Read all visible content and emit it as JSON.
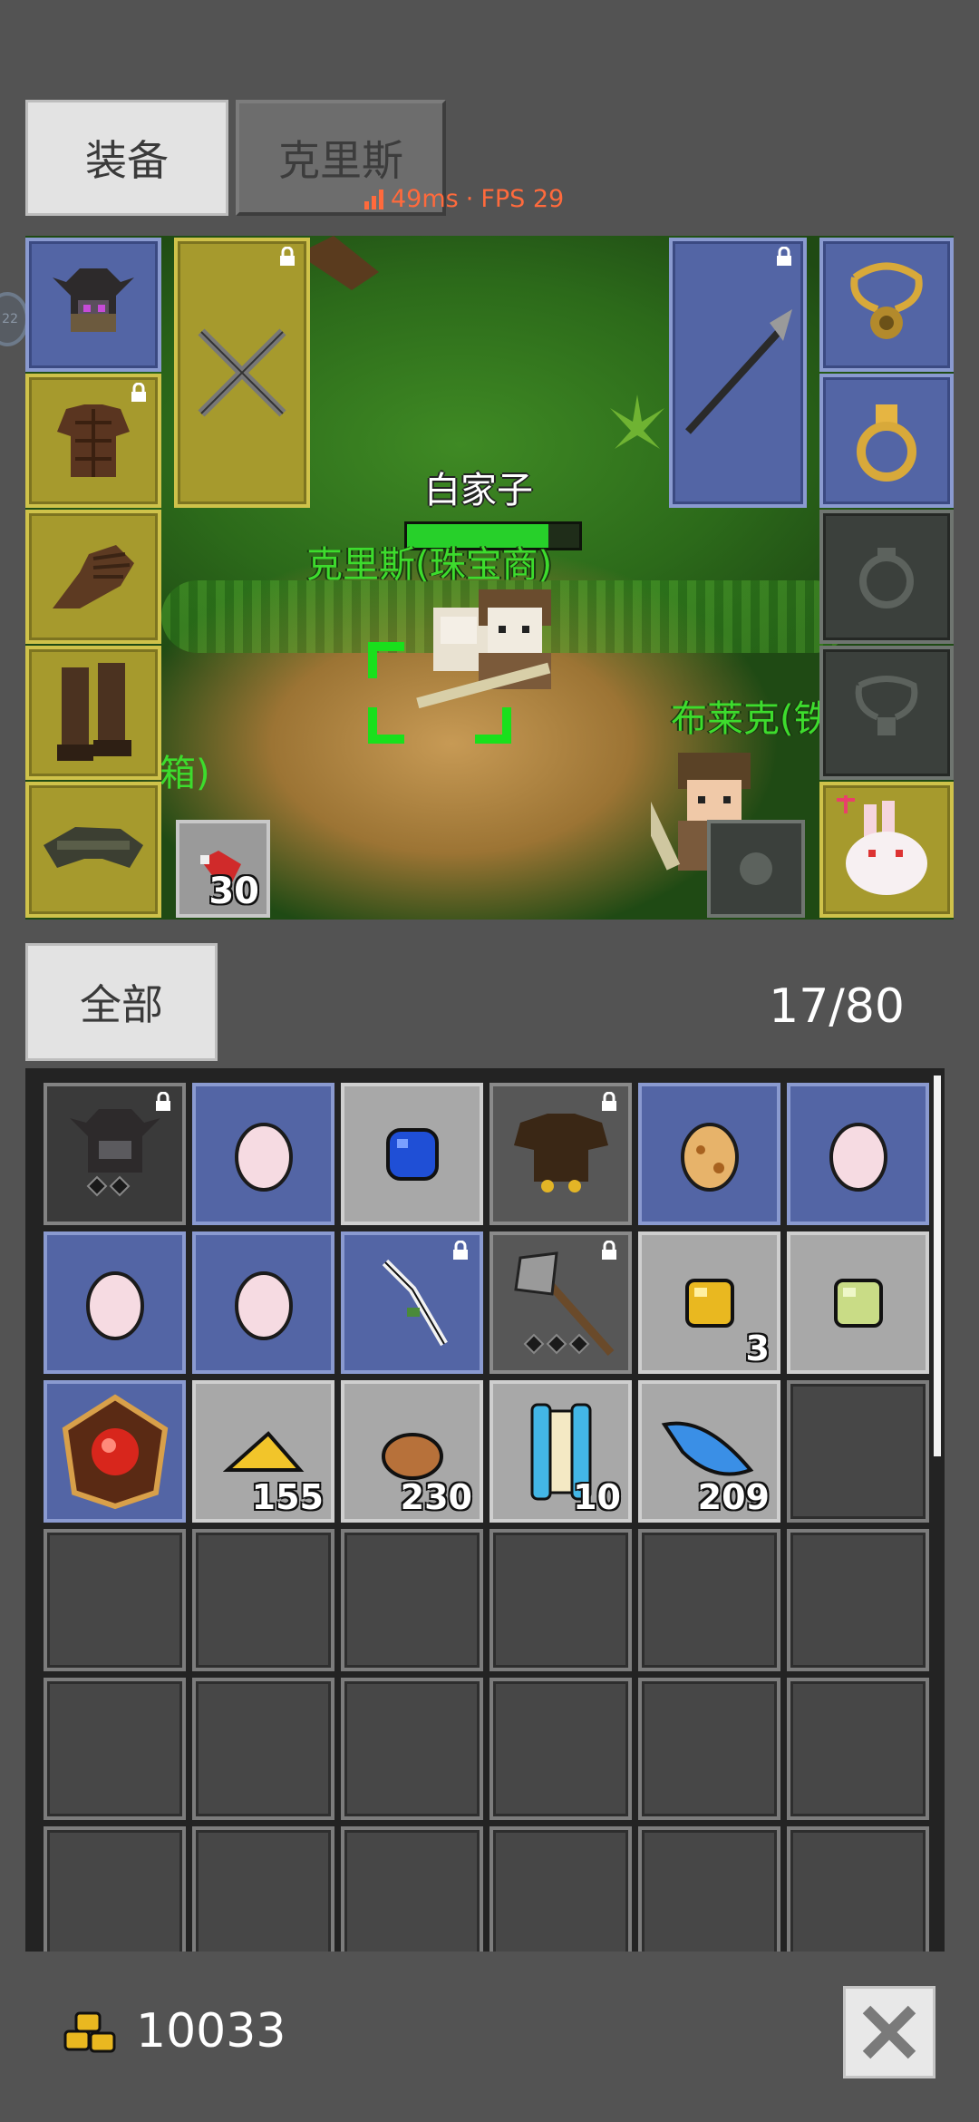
{
  "tabs": [
    {
      "label": "装备",
      "active": true
    },
    {
      "label": "克里斯",
      "active": false
    }
  ],
  "network": {
    "ping": "49ms",
    "separator": "·",
    "fps": "FPS 29"
  },
  "side_indicator": "22",
  "scene": {
    "target_name": "白家子",
    "target_hp_percent": 82,
    "npc_main": "克里斯(珠宝商)",
    "npc_right": "布莱克(铁匠)",
    "npc_left_partial": "箱)",
    "quick_slot_count": "30"
  },
  "filter": {
    "label": "全部"
  },
  "capacity": "17/80",
  "inventory_counts": {
    "gold_nugget": "3",
    "cheese": "155",
    "bread": "230",
    "scroll": "10",
    "feather": "209"
  },
  "gold": "10033",
  "colors": {
    "background": "#535353",
    "slot_yellow": "#a69a2d",
    "slot_blue": "#5365a5",
    "name_green": "#3ddc2d",
    "ping_orange": "#ff6a3c"
  }
}
